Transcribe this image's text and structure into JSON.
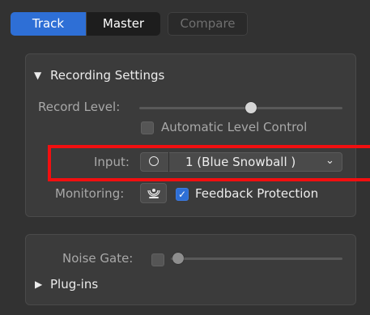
{
  "tabs": {
    "track": "Track",
    "master": "Master",
    "compare": "Compare"
  },
  "recording": {
    "section_title": "Recording Settings",
    "record_level_label": "Record Level:",
    "record_level_value": 0.55,
    "auto_level_label": "Automatic Level Control",
    "auto_level_checked": false,
    "input_label": "Input:",
    "input_value": "1 (Blue Snowball )",
    "monitoring_label": "Monitoring:",
    "feedback_label": "Feedback Protection",
    "feedback_checked": true
  },
  "lower": {
    "noise_gate_label": "Noise Gate:",
    "noise_gate_checked": false,
    "noise_gate_value": 0.0,
    "plugins_label": "Plug-ins"
  },
  "colors": {
    "accent": "#2e6fd6",
    "highlight": "#f20f10",
    "background": "#323232"
  }
}
